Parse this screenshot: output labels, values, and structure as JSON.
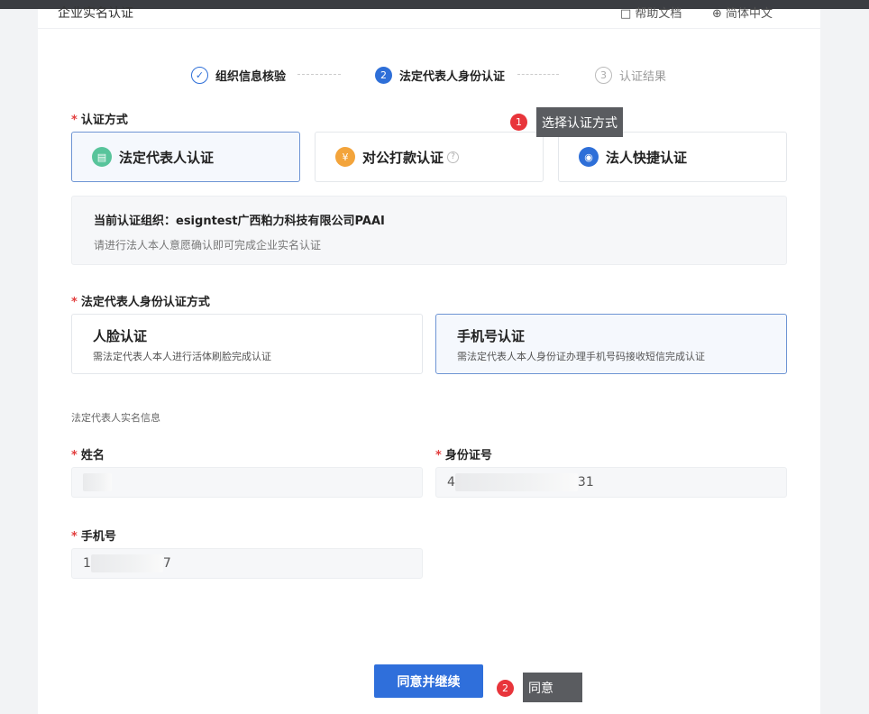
{
  "header": {
    "title": "企业实名认证",
    "help": "帮助文档",
    "lang": "简体中文"
  },
  "steps": [
    {
      "num": "✓",
      "label": "组织信息核验"
    },
    {
      "num": "2",
      "label": "法定代表人身份认证"
    },
    {
      "num": "3",
      "label": "认证结果"
    }
  ],
  "auth_method": {
    "label": "认证方式",
    "options": [
      {
        "label": "法定代表人认证",
        "icon": "document-icon",
        "color": "#58c49b",
        "glyph": "▤"
      },
      {
        "label": "对公打款认证",
        "icon": "yuan-icon",
        "color": "#f3a43b",
        "glyph": "¥",
        "help": "?"
      },
      {
        "label": "法人快捷认证",
        "icon": "shield-eye-icon",
        "color": "#2e6fd8",
        "glyph": "◉"
      }
    ]
  },
  "info": {
    "title": "当前认证组织：esigntest广西粕力科技有限公司PAAI",
    "desc": "请进行法人本人意愿确认即可完成企业实名认证"
  },
  "identity": {
    "label": "法定代表人身份认证方式",
    "options": [
      {
        "title": "人脸认证",
        "desc": "需法定代表人本人进行活体刷脸完成认证"
      },
      {
        "title": "手机号认证",
        "desc": "需法定代表人本人身份证办理手机号码接收短信完成认证"
      }
    ]
  },
  "realname_section": "法定代表人实名信息",
  "fields": {
    "name_label": "姓名",
    "id_label": "身份证号",
    "id_prefix": "4",
    "id_suffix": "31",
    "phone_label": "手机号",
    "phone_prefix": "1",
    "phone_suffix": "7"
  },
  "required_mark": "*",
  "submit_label": "同意并继续",
  "annotations": [
    {
      "num": "1",
      "text": "选择认证方式"
    },
    {
      "num": "2",
      "text": "同意"
    }
  ],
  "colors": {
    "primary": "#2f6fdb",
    "required": "#e23d3d",
    "badge": "#e8353b",
    "tooltip": "#5a5c60"
  }
}
